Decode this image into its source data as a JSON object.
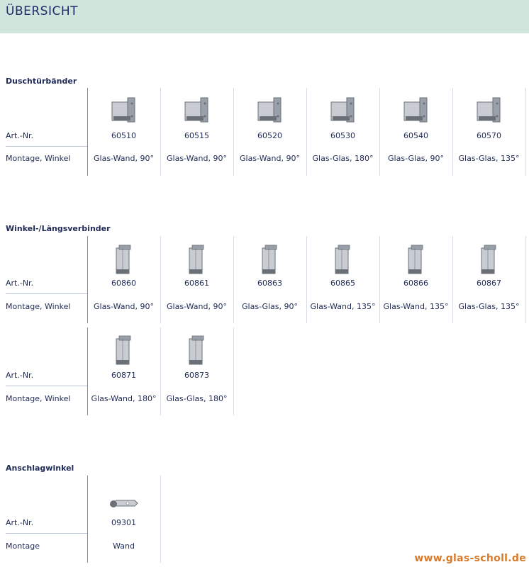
{
  "header": {
    "title": "ÜBERSICHT"
  },
  "sections": [
    {
      "title": "Duschtürbänder",
      "label_art": "Art.-Nr.",
      "label_mount": "Montage, Winkel",
      "rows": [
        [
          {
            "art": "60510",
            "mount": "Glas-Wand, 90°",
            "icon": "hinge-wall-icon"
          },
          {
            "art": "60515",
            "mount": "Glas-Wand, 90°",
            "icon": "hinge-wall-long-icon"
          },
          {
            "art": "60520",
            "mount": "Glas-Wand, 90°",
            "icon": "hinge-wall-wide-icon"
          },
          {
            "art": "60530",
            "mount": "Glas-Glas, 180°",
            "icon": "hinge-glass-180-icon"
          },
          {
            "art": "60540",
            "mount": "Glas-Glas, 90°",
            "icon": "hinge-glass-90-icon"
          },
          {
            "art": "60570",
            "mount": "Glas-Glas, 135°",
            "icon": "hinge-glass-135-icon"
          }
        ]
      ]
    },
    {
      "title": "Winkel-/Längsverbinder",
      "label_art": "Art.-Nr.",
      "label_mount": "Montage, Winkel",
      "rows": [
        [
          {
            "art": "60860",
            "mount": "Glas-Wand, 90°",
            "icon": "connector-wall-90-icon"
          },
          {
            "art": "60861",
            "mount": "Glas-Wand, 90°",
            "icon": "connector-wall-90-small-icon"
          },
          {
            "art": "60863",
            "mount": "Glas-Glas, 90°",
            "icon": "connector-glass-90-icon"
          },
          {
            "art": "60865",
            "mount": "Glas-Wand, 135°",
            "icon": "connector-wall-135-icon"
          },
          {
            "art": "60866",
            "mount": "Glas-Wand, 135°",
            "icon": "connector-wall-135-b-icon"
          },
          {
            "art": "60867",
            "mount": "Glas-Glas, 135°",
            "icon": "connector-glass-135-icon"
          }
        ],
        [
          {
            "art": "60871",
            "mount": "Glas-Wand, 180°",
            "icon": "connector-wall-180-icon"
          },
          {
            "art": "60873",
            "mount": "Glas-Glas, 180°",
            "icon": "connector-glass-180-icon"
          }
        ]
      ]
    },
    {
      "title": "Anschlagwinkel",
      "label_art": "Art.-Nr.",
      "label_mount": "Montage",
      "rows": [
        [
          {
            "art": "09301",
            "mount": "Wand",
            "icon": "stop-angle-icon"
          }
        ]
      ]
    }
  ],
  "footer": {
    "url": "www.glas-scholl.de"
  },
  "colors": {
    "header_bg": "#cfe6dc",
    "text": "#1f2a55",
    "footer": "#d97a2a"
  }
}
